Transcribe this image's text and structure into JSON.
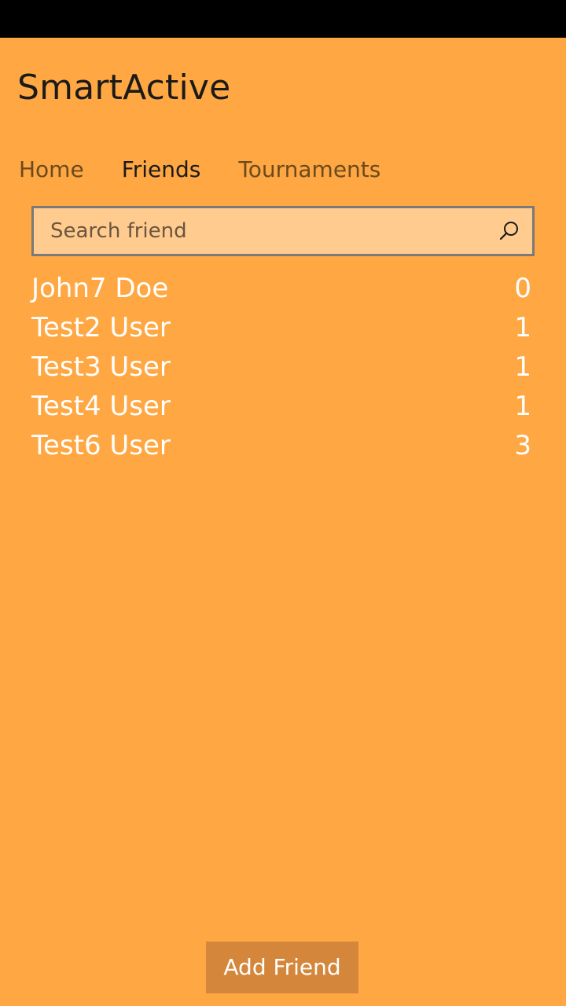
{
  "app": {
    "title": "SmartActive"
  },
  "pivot": {
    "tabs": [
      {
        "label": "Home"
      },
      {
        "label": "Friends"
      },
      {
        "label": "Tournaments"
      }
    ],
    "active": "Friends"
  },
  "search": {
    "placeholder": "Search friend",
    "value": "",
    "icon": "search-icon"
  },
  "friends": [
    {
      "name": "John7 Doe",
      "count": "0"
    },
    {
      "name": "Test2 User",
      "count": "1"
    },
    {
      "name": "Test3 User",
      "count": "1"
    },
    {
      "name": "Test4 User",
      "count": "1"
    },
    {
      "name": "Test6 User",
      "count": "3"
    }
  ],
  "actions": {
    "add_friend_label": "Add Friend"
  },
  "colors": {
    "background": "#ffa742",
    "status_bar": "#000000",
    "search_background": "#ffcb8e",
    "button_background": "#d4873a",
    "text_light": "#ffffff"
  }
}
